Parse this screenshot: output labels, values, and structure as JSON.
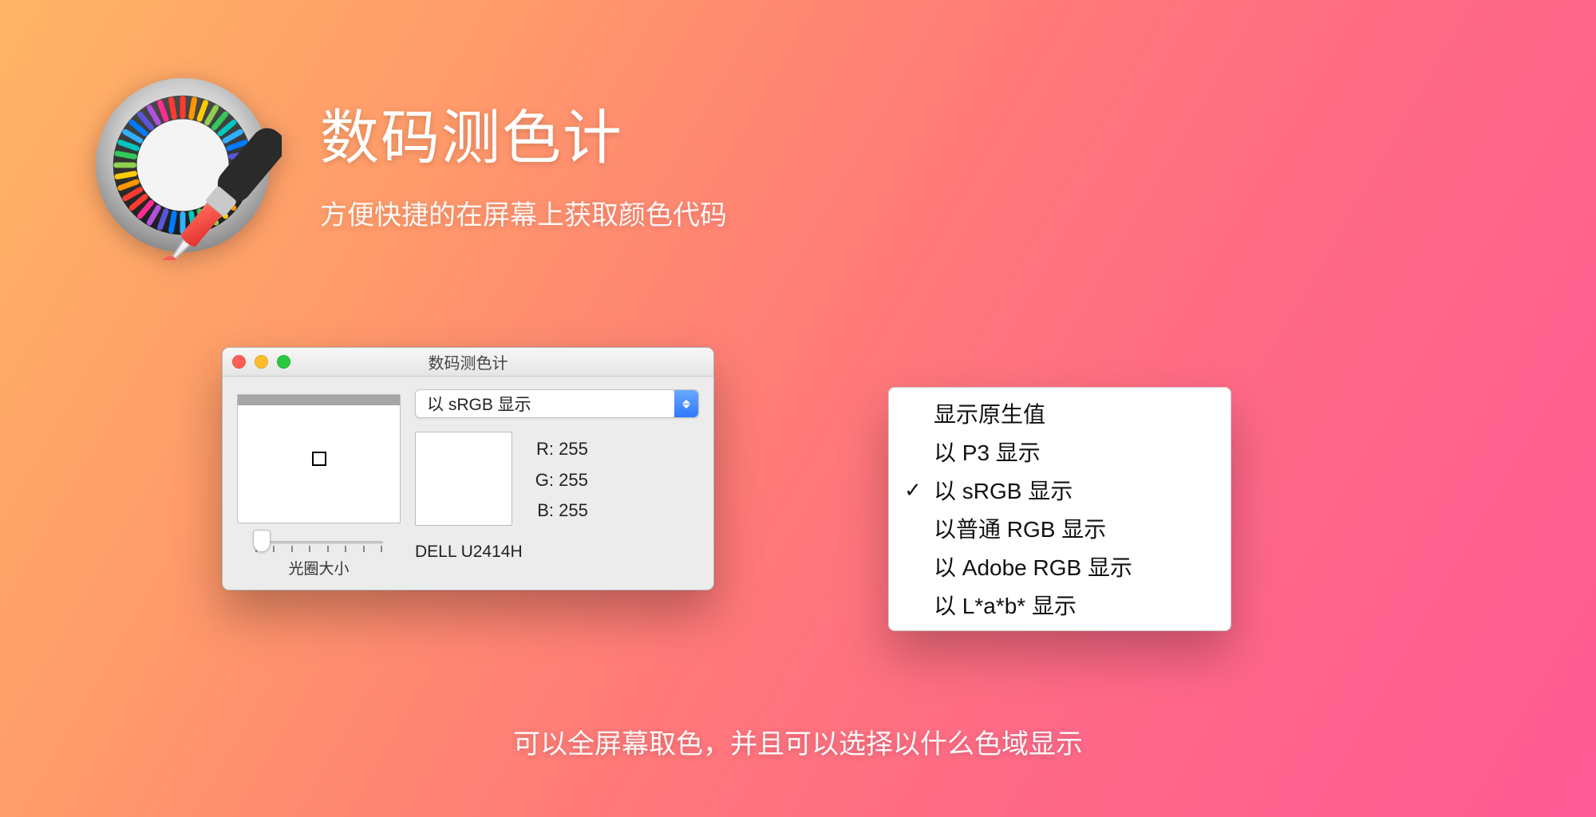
{
  "hero": {
    "title": "数码测色计",
    "subtitle": "方便快捷的在屏幕上获取颜色代码"
  },
  "window": {
    "title": "数码测色计",
    "dropdown_selected": "以 sRGB 显示",
    "rgb": {
      "r_label": "R:",
      "g_label": "G:",
      "b_label": "B:",
      "r_value": "255",
      "g_value": "255",
      "b_value": "255"
    },
    "display_name": "DELL U2414H",
    "slider_label": "光圈大小"
  },
  "menu": {
    "items": [
      {
        "label": "显示原生值",
        "checked": false
      },
      {
        "label": "以 P3 显示",
        "checked": false
      },
      {
        "label": "以 sRGB 显示",
        "checked": true
      },
      {
        "label": "以普通 RGB 显示",
        "checked": false
      },
      {
        "label": "以 Adobe RGB 显示",
        "checked": false
      },
      {
        "label": "以 L*a*b* 显示",
        "checked": false
      }
    ]
  },
  "caption": "可以全屏幕取色，并且可以选择以什么色域显示"
}
